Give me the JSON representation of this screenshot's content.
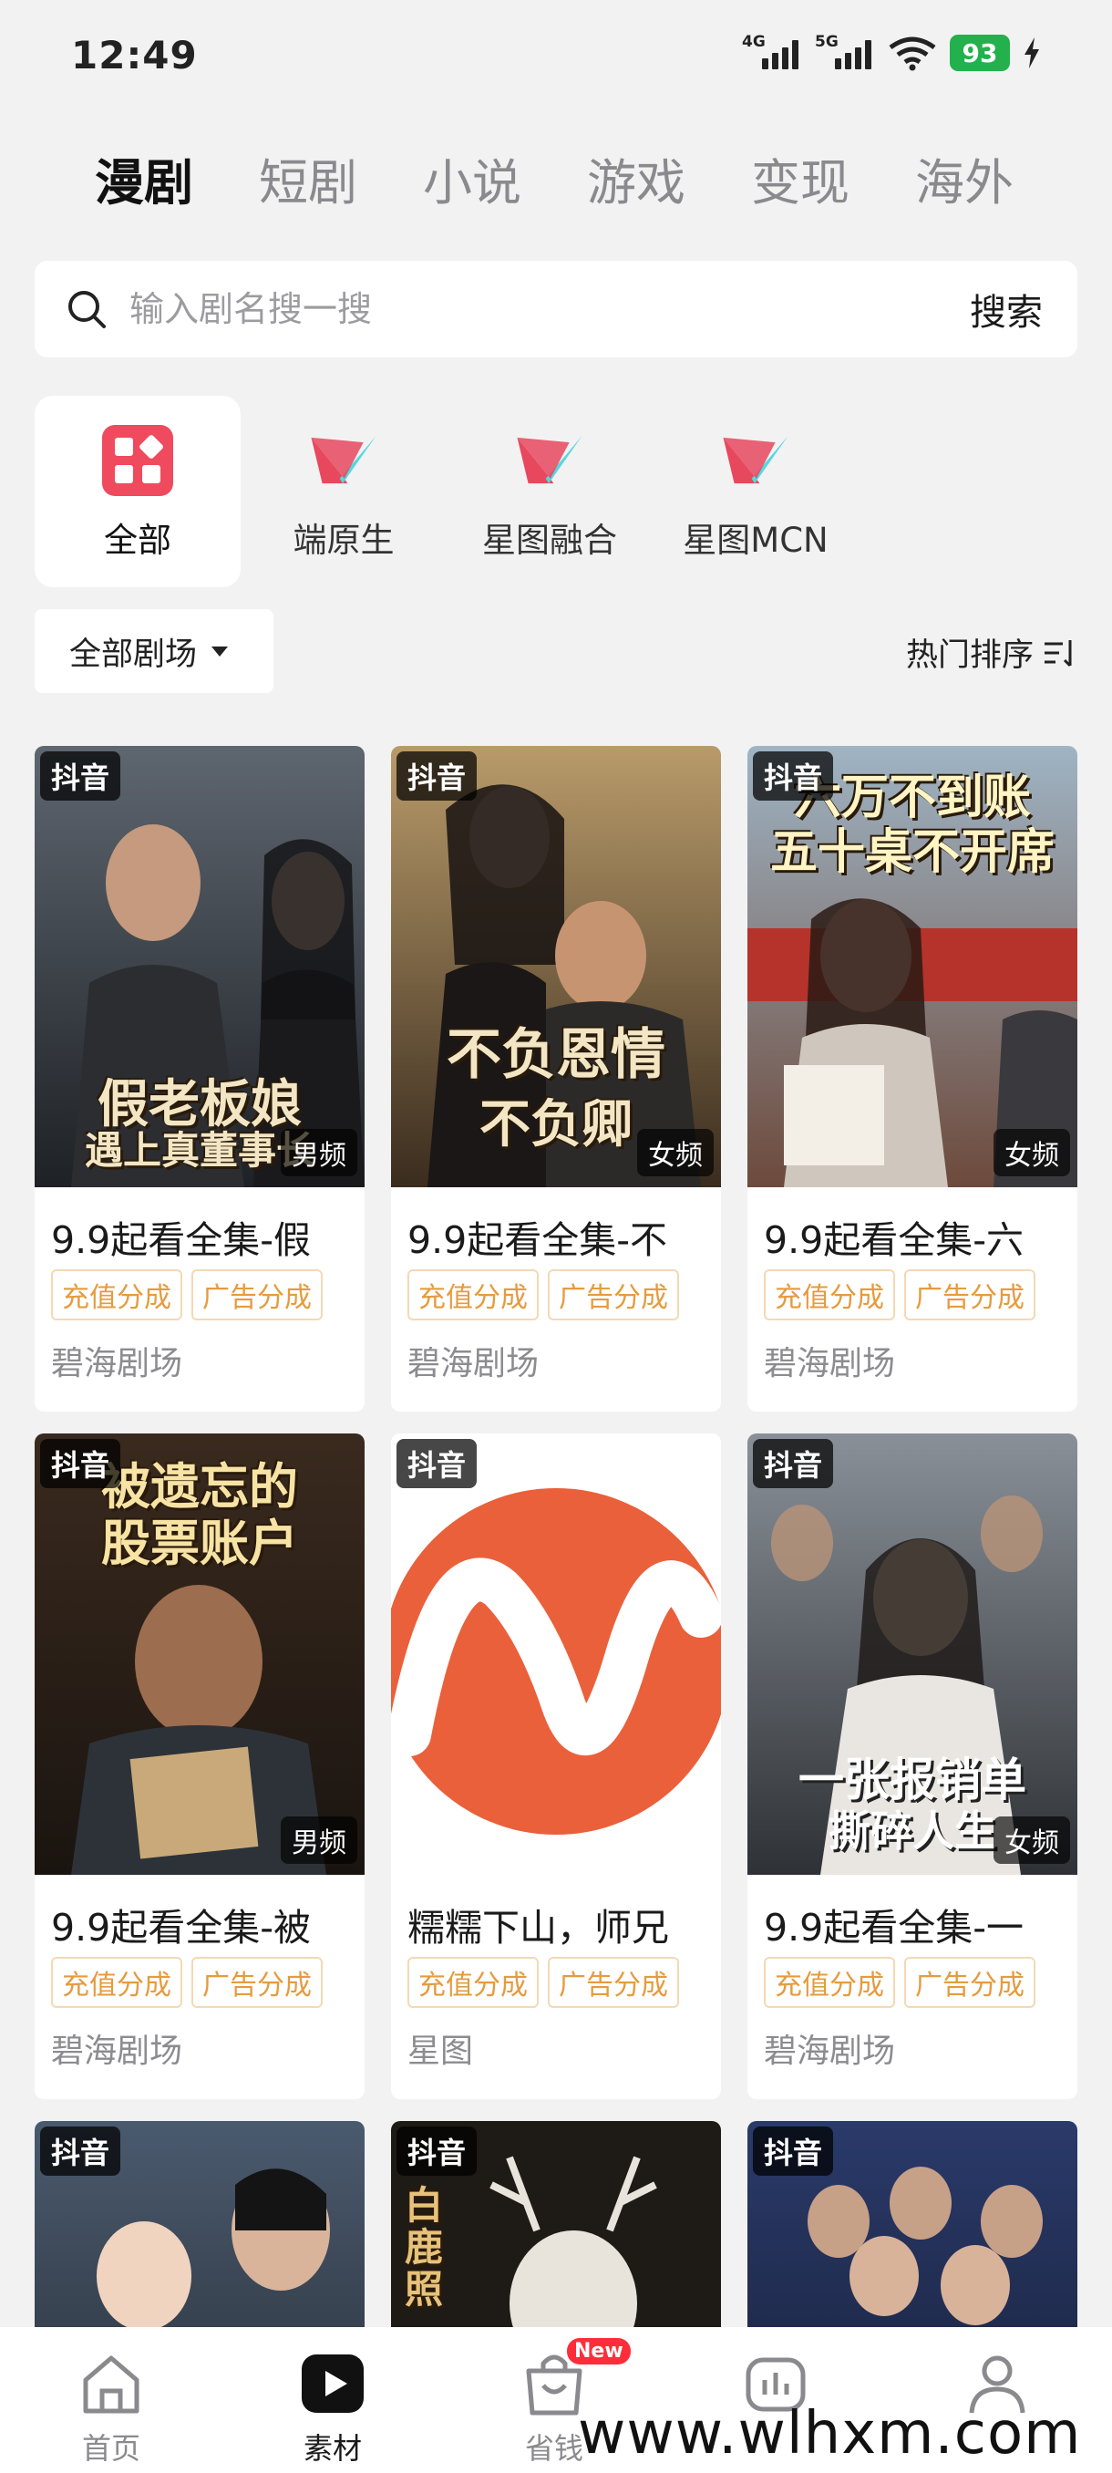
{
  "status_bar": {
    "time": "12:49",
    "signal_1": "4G",
    "signal_2": "5G",
    "battery": "93"
  },
  "top_tabs": [
    {
      "label": "漫剧",
      "active": true
    },
    {
      "label": "短剧",
      "active": false
    },
    {
      "label": "小说",
      "active": false
    },
    {
      "label": "游戏",
      "active": false
    },
    {
      "label": "变现",
      "active": false
    },
    {
      "label": "海外",
      "active": false
    }
  ],
  "search": {
    "placeholder": "输入剧名搜一搜",
    "button": "搜索"
  },
  "categories": [
    {
      "label": "全部",
      "icon": "grid-icon"
    },
    {
      "label": "端原生",
      "icon": "xingtu-logo-icon"
    },
    {
      "label": "星图融合",
      "icon": "xingtu-logo-icon"
    },
    {
      "label": "星图MCN",
      "icon": "xingtu-logo-icon"
    }
  ],
  "filter": {
    "label": "全部剧场"
  },
  "sort": {
    "label": "热门排序"
  },
  "cards": [
    {
      "platform": "抖音",
      "gender": "男频",
      "cover_text": [
        "假老板娘",
        "遇上真董事长"
      ],
      "title": "9.9起看全集-假",
      "tags": [
        "充值分成",
        "广告分成"
      ],
      "source": "碧海剧场"
    },
    {
      "platform": "抖音",
      "gender": "女频",
      "cover_text": [
        "不负恩情",
        "不负卿"
      ],
      "title": "9.9起看全集-不",
      "tags": [
        "充值分成",
        "广告分成"
      ],
      "source": "碧海剧场"
    },
    {
      "platform": "抖音",
      "gender": "女频",
      "cover_text": [
        "六万不到账",
        "五十桌不开席"
      ],
      "title": "9.9起看全集-六",
      "tags": [
        "充值分成",
        "广告分成"
      ],
      "source": "碧海剧场"
    },
    {
      "platform": "抖音",
      "gender": "男频",
      "cover_text": [
        "被遗忘的",
        "股票账户"
      ],
      "title": "9.9起看全集-被",
      "tags": [
        "充值分成",
        "广告分成"
      ],
      "source": "碧海剧场"
    },
    {
      "platform": "抖音",
      "gender": "",
      "cover_text": [],
      "title": "糯糯下山，师兄",
      "tags": [
        "充值分成",
        "广告分成"
      ],
      "source": "星图"
    },
    {
      "platform": "抖音",
      "gender": "女频",
      "cover_text": [
        "一张报销单",
        "撕碎人生"
      ],
      "title": "9.9起看全集-一",
      "tags": [
        "充值分成",
        "广告分成"
      ],
      "source": "碧海剧场"
    },
    {
      "platform": "抖音",
      "gender": "",
      "cover_text": [],
      "title": "",
      "tags": [],
      "source": ""
    },
    {
      "platform": "抖音",
      "gender": "",
      "cover_text": [
        "白鹿照"
      ],
      "title": "",
      "tags": [],
      "source": ""
    },
    {
      "platform": "抖音",
      "gender": "",
      "cover_text": [],
      "title": "",
      "tags": [],
      "source": ""
    }
  ],
  "bottom_nav": [
    {
      "label": "首页",
      "icon": "home-icon",
      "active": false
    },
    {
      "label": "素材",
      "icon": "play-icon",
      "active": true
    },
    {
      "label": "省钱",
      "icon": "bag-icon",
      "active": false,
      "badge": "New"
    },
    {
      "label": "",
      "icon": "chart-icon",
      "active": false
    },
    {
      "label": "",
      "icon": "user-icon",
      "active": false
    }
  ],
  "watermark": "www.wlhxm.com",
  "colors": {
    "accent_red": "#f04a5e",
    "tag_orange": "#e59b3e",
    "battery_green": "#22b14c",
    "new_badge": "#ff2d3a"
  }
}
